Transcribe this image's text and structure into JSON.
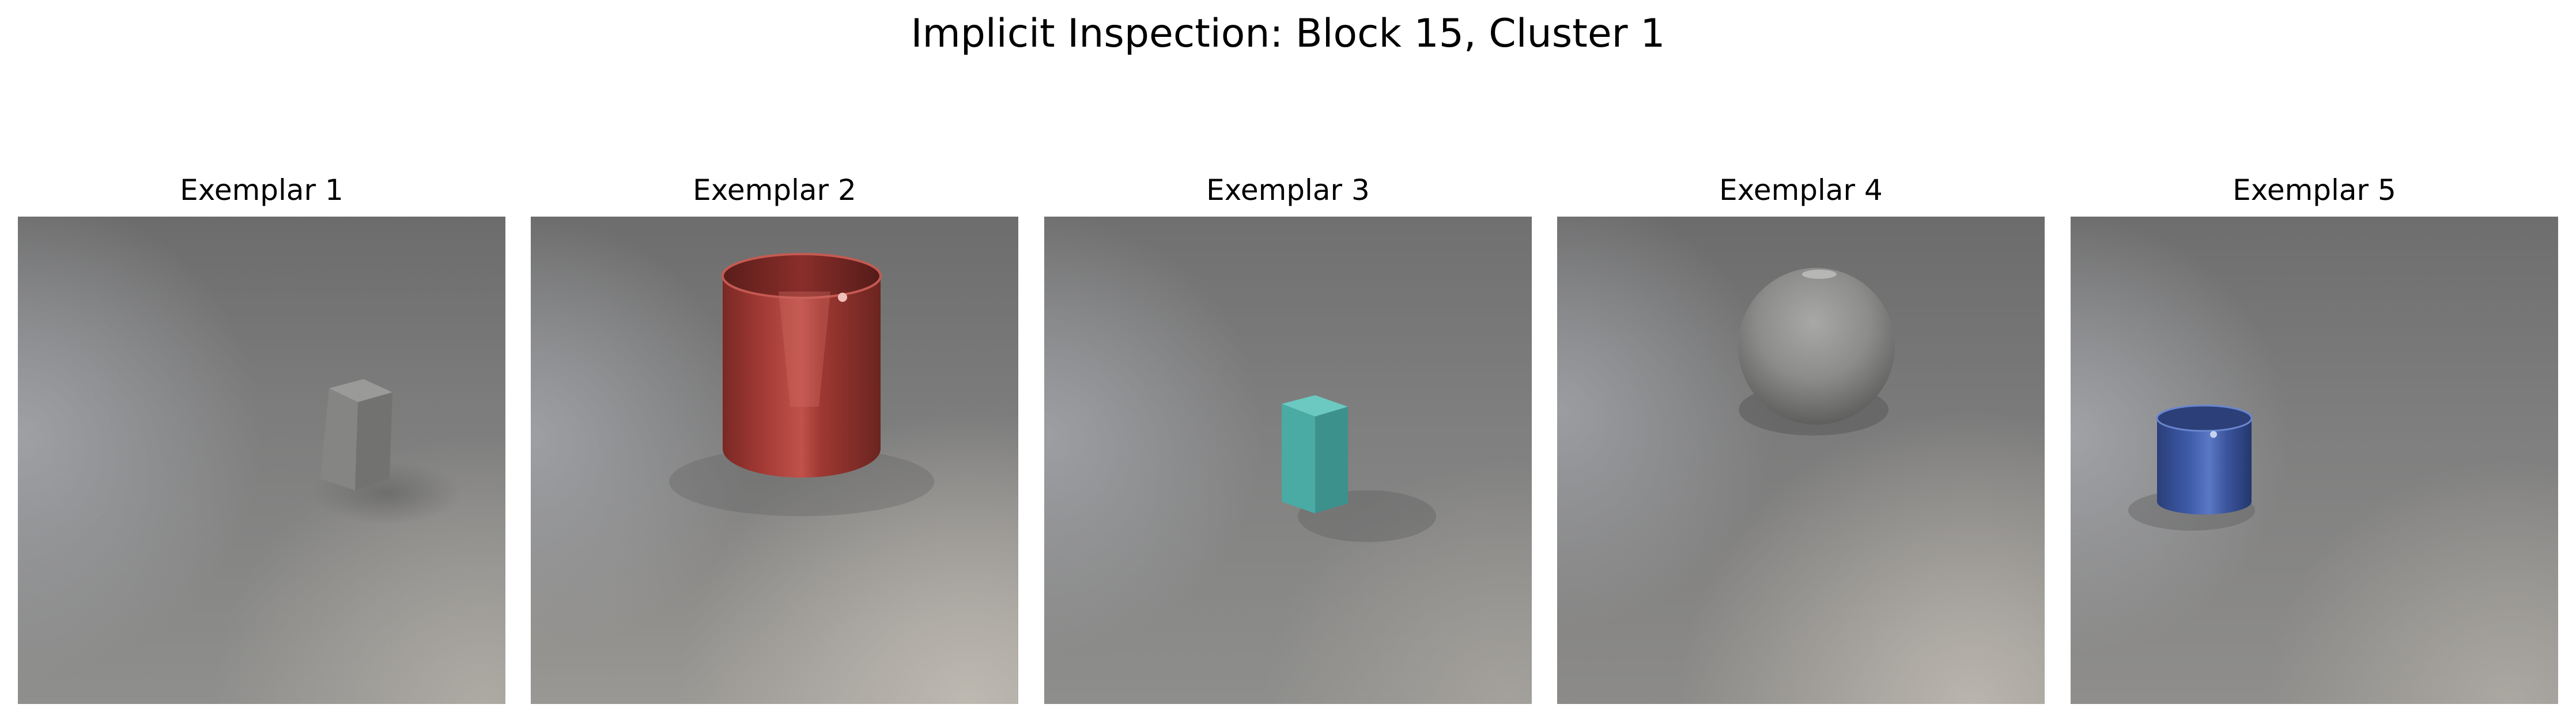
{
  "figure": {
    "title": "Implicit Inspection: Block 15, Cluster 1"
  },
  "panels": [
    {
      "title": "Exemplar 1",
      "object": "gray-cube-icon",
      "color": "#8a8a87"
    },
    {
      "title": "Exemplar 2",
      "object": "red-metal-cylinder-icon",
      "color": "#b0453f"
    },
    {
      "title": "Exemplar 3",
      "object": "cyan-cube-icon",
      "color": "#45a9a3"
    },
    {
      "title": "Exemplar 4",
      "object": "gray-sphere-icon",
      "color": "#8d8d8b"
    },
    {
      "title": "Exemplar 5",
      "object": "blue-metal-cylinder-icon",
      "color": "#3d5aa8"
    }
  ]
}
